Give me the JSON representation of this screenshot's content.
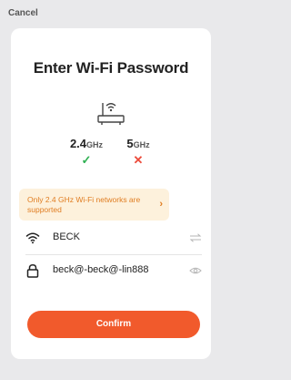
{
  "header": {
    "cancel_label": "Cancel"
  },
  "dialog": {
    "title": "Enter Wi-Fi Password",
    "bands": [
      {
        "prefix": "2.4",
        "unit": "GHz",
        "status": "supported",
        "mark": "✓"
      },
      {
        "prefix": "5",
        "unit": "GHz",
        "status": "not-supported",
        "mark": "✕"
      }
    ],
    "notice": {
      "text": "Only 2.4 GHz Wi-Fi networks are supported",
      "arrow": "›"
    },
    "network": {
      "ssid": "BECK",
      "icon": "wifi-icon",
      "action_icon": "switch-network-icon"
    },
    "password": {
      "value": "beck@-beck@-lin888",
      "icon": "lock-icon",
      "action_icon": "eye-icon"
    },
    "confirm_label": "Confirm"
  },
  "colors": {
    "accent": "#f15a2c",
    "success": "#2fb052",
    "error": "#ec4b3b",
    "notice_bg": "#fdf1dc",
    "notice_text": "#e07d22"
  }
}
